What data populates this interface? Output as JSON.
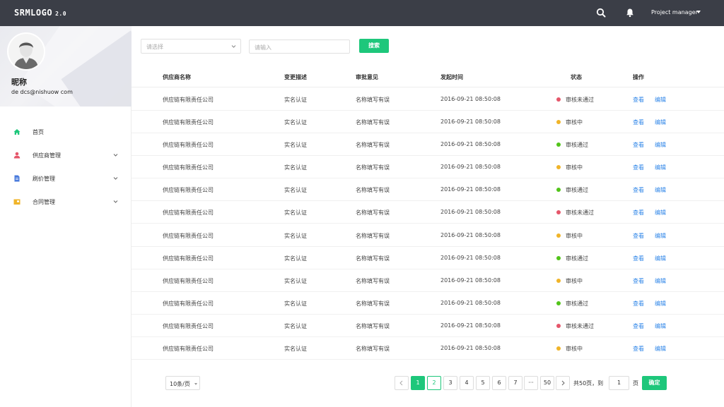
{
  "header": {
    "logo": "SRMLOGO",
    "version": "2.0",
    "user": "Project manager",
    "search_icon": "search-icon",
    "bell_icon": "bell-icon"
  },
  "profile": {
    "nickname": "昵称",
    "email": "de dcs@nishuow com"
  },
  "menu": [
    {
      "label": "首页",
      "icon": "home-icon",
      "color": "#1ec77b"
    },
    {
      "label": "供应商管理",
      "icon": "user-icon",
      "color": "#e5566a"
    },
    {
      "label": "刷价管理",
      "icon": "document-icon",
      "color": "#4a7bdc"
    },
    {
      "label": "合同管理",
      "icon": "folder-icon",
      "color": "#f0b429"
    }
  ],
  "filters": {
    "select_placeholder": "请选择",
    "input_placeholder": "请输入",
    "search_label": "搜索"
  },
  "table": {
    "headers": [
      "供应商名称",
      "变更描述",
      "审批意见",
      "发起时间",
      "状态",
      "操作"
    ],
    "rows": [
      {
        "supplier": "供应链有限责任公司",
        "desc": "实名认证",
        "opinion": "名称填写有误",
        "time": "2016-09-21  08:50:08",
        "status": "审核未通过",
        "status_color": "#e5566a",
        "view": "查看",
        "edit": "编辑"
      },
      {
        "supplier": "供应链有限责任公司",
        "desc": "实名认证",
        "opinion": "名称填写有误",
        "time": "2016-09-21  08:50:08",
        "status": "审核中",
        "status_color": "#f0b429",
        "view": "查看",
        "edit": "编辑"
      },
      {
        "supplier": "供应链有限责任公司",
        "desc": "实名认证",
        "opinion": "名称填写有误",
        "time": "2016-09-21  08:50:08",
        "status": "审核通过",
        "status_color": "#52c41a",
        "view": "查看",
        "edit": "编辑"
      },
      {
        "supplier": "供应链有限责任公司",
        "desc": "实名认证",
        "opinion": "名称填写有误",
        "time": "2016-09-21  08:50:08",
        "status": "审核中",
        "status_color": "#f0b429",
        "view": "查看",
        "edit": "编辑"
      },
      {
        "supplier": "供应链有限责任公司",
        "desc": "实名认证",
        "opinion": "名称填写有误",
        "time": "2016-09-21  08:50:08",
        "status": "审核通过",
        "status_color": "#52c41a",
        "view": "查看",
        "edit": "编辑"
      },
      {
        "supplier": "供应链有限责任公司",
        "desc": "实名认证",
        "opinion": "名称填写有误",
        "time": "2016-09-21  08:50:08",
        "status": "审核未通过",
        "status_color": "#e5566a",
        "view": "查看",
        "edit": "编辑"
      },
      {
        "supplier": "供应链有限责任公司",
        "desc": "实名认证",
        "opinion": "名称填写有误",
        "time": "2016-09-21  08:50:08",
        "status": "审核中",
        "status_color": "#f0b429",
        "view": "查看",
        "edit": "编辑"
      },
      {
        "supplier": "供应链有限责任公司",
        "desc": "实名认证",
        "opinion": "名称填写有误",
        "time": "2016-09-21  08:50:08",
        "status": "审核通过",
        "status_color": "#52c41a",
        "view": "查看",
        "edit": "编辑"
      },
      {
        "supplier": "供应链有限责任公司",
        "desc": "实名认证",
        "opinion": "名称填写有误",
        "time": "2016-09-21  08:50:08",
        "status": "审核中",
        "status_color": "#f0b429",
        "view": "查看",
        "edit": "编辑"
      },
      {
        "supplier": "供应链有限责任公司",
        "desc": "实名认证",
        "opinion": "名称填写有误",
        "time": "2016-09-21  08:50:08",
        "status": "审核通过",
        "status_color": "#52c41a",
        "view": "查看",
        "edit": "编辑"
      },
      {
        "supplier": "供应链有限责任公司",
        "desc": "实名认证",
        "opinion": "名称填写有误",
        "time": "2016-09-21  08:50:08",
        "status": "审核未通过",
        "status_color": "#e5566a",
        "view": "查看",
        "edit": "编辑"
      },
      {
        "supplier": "供应链有限责任公司",
        "desc": "实名认证",
        "opinion": "名称填写有误",
        "time": "2016-09-21  08:50:08",
        "status": "审核中",
        "status_color": "#f0b429",
        "view": "查看",
        "edit": "编辑"
      }
    ]
  },
  "pagination": {
    "page_size": "10条/页",
    "pages": [
      "1",
      "2",
      "3",
      "4",
      "5",
      "6",
      "7",
      "···",
      "50"
    ],
    "current": "1",
    "total_text": "共50页，到",
    "goto_value": "1",
    "unit": "页",
    "confirm": "确定"
  },
  "colors": {
    "accent": "#1ec77b",
    "link": "#2f86e8",
    "topbar": "#3b3e47"
  }
}
